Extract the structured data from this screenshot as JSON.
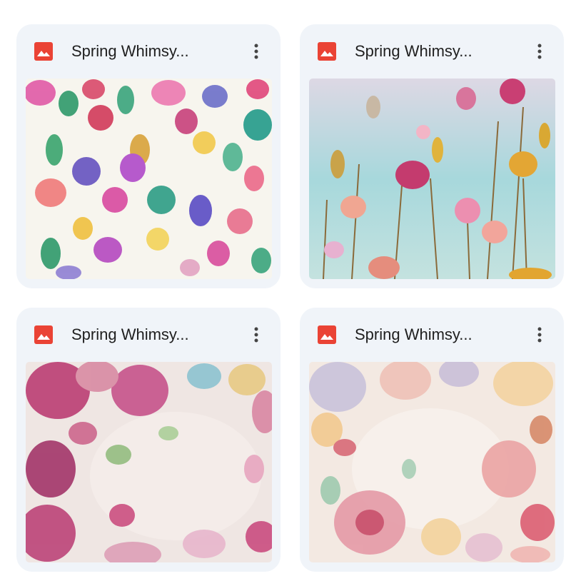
{
  "files": [
    {
      "title": "Spring Whimsy...",
      "icon": "image-file-icon",
      "thumbnail": "bright watercolor wildflower pattern",
      "icon_color": "#ea4335"
    },
    {
      "title": "Spring Whimsy...",
      "icon": "image-file-icon",
      "thumbnail": "tall watercolor flowers on aqua",
      "icon_color": "#ea4335"
    },
    {
      "title": "Spring Whimsy...",
      "icon": "image-file-icon",
      "thumbnail": "magenta floral frame on cream",
      "icon_color": "#ea4335"
    },
    {
      "title": "Spring Whimsy...",
      "icon": "image-file-icon",
      "thumbnail": "pastel rose frame on cream",
      "icon_color": "#ea4335"
    }
  ],
  "more_icon": "more-vert-icon"
}
